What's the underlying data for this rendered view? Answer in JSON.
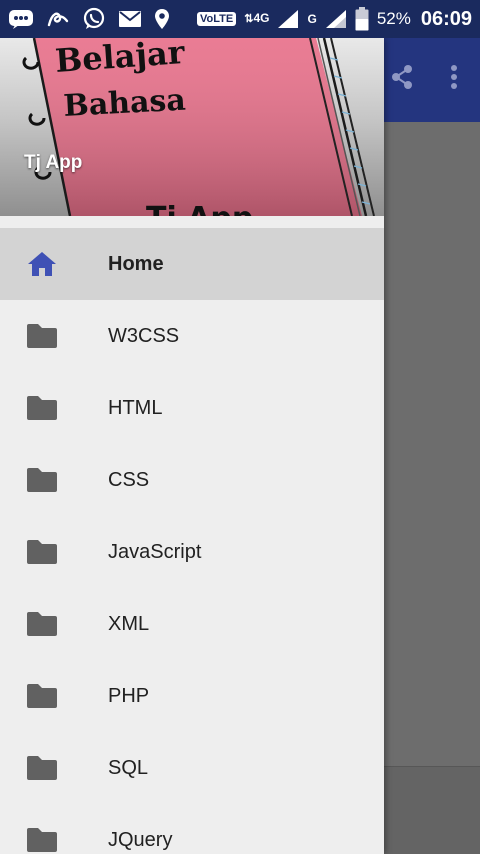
{
  "statusbar": {
    "volte": "VoLTE",
    "network_1": "4G",
    "network_2": "G",
    "battery": "52%",
    "time": "06:09"
  },
  "header": {
    "title": "Tj App",
    "art_line_1": "Belajar",
    "art_line_2": "Bahasa",
    "art_bottom": "Tj App"
  },
  "nav": {
    "items": [
      {
        "label": "Home",
        "icon": "home-icon",
        "active": true
      },
      {
        "label": "W3CSS",
        "icon": "folder-icon"
      },
      {
        "label": "HTML",
        "icon": "folder-icon"
      },
      {
        "label": "CSS",
        "icon": "folder-icon"
      },
      {
        "label": "JavaScript",
        "icon": "folder-icon"
      },
      {
        "label": "XML",
        "icon": "folder-icon"
      },
      {
        "label": "PHP",
        "icon": "folder-icon"
      },
      {
        "label": "SQL",
        "icon": "folder-icon"
      },
      {
        "label": "JQuery",
        "icon": "folder-icon"
      }
    ]
  },
  "app_bar": {
    "actions": [
      "share-icon",
      "more-vert-icon"
    ]
  },
  "colors": {
    "status_bar": "#1a2a5e",
    "app_bar": "#24357f",
    "drawer_bg": "#eeeeee",
    "active_item_bg": "#d3d3d3",
    "home_icon": "#3f51b5",
    "folder_icon": "#616161",
    "notebook_pink": "#e8708a"
  }
}
